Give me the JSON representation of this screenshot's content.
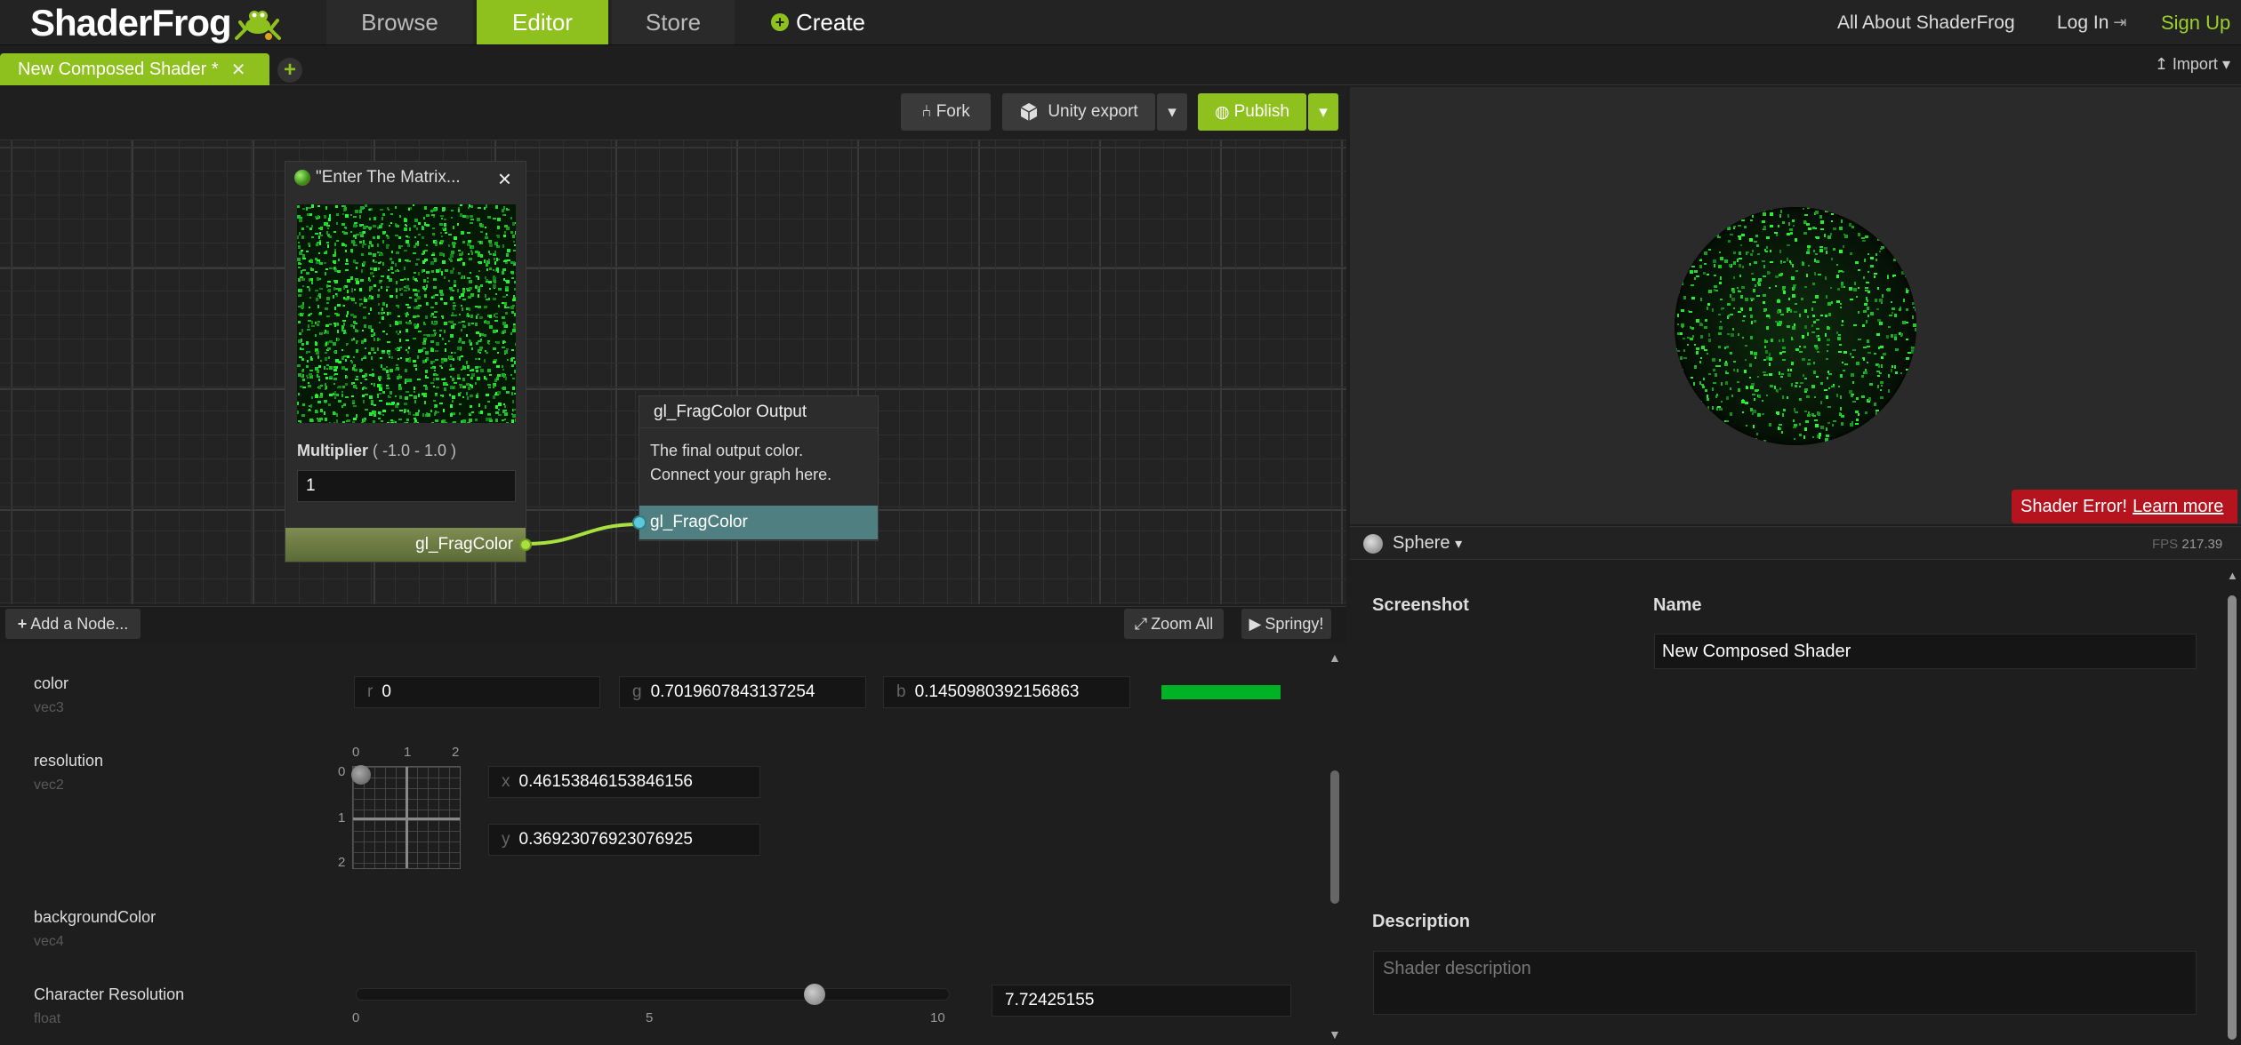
{
  "nav": {
    "logo": "ShaderFrog",
    "browse": "Browse",
    "editor": "Editor",
    "store": "Store",
    "create": "Create",
    "about": "All About ShaderFrog",
    "login": "Log In",
    "signup": "Sign Up",
    "active_color": "#8ec11d"
  },
  "tabs": {
    "active": "New Composed Shader *",
    "close_glyph": "✕",
    "add_glyph": "+",
    "import": "Import"
  },
  "toolbar": {
    "fork": "Fork",
    "unity_export": "Unity export",
    "publish": "Publish"
  },
  "graph": {
    "node1": {
      "title": "\"Enter The Matrix...",
      "multiplier_label": "Multiplier",
      "multiplier_range": "( -1.0 - 1.0 )",
      "multiplier_value": "1",
      "output_port": "gl_FragColor"
    },
    "node2": {
      "title": "gl_FragColor Output",
      "desc_line1": "The final output color.",
      "desc_line2": "Connect your graph here.",
      "input_port": "gl_FragColor"
    },
    "add_node": "Add a Node...",
    "zoom_all": "Zoom All",
    "springy": "Springy!"
  },
  "uniforms": [
    {
      "name": "color",
      "type": "vec3"
    },
    {
      "name": "resolution",
      "type": "vec2"
    },
    {
      "name": "backgroundColor",
      "type": "vec4"
    },
    {
      "name": "Character Resolution",
      "type": "float"
    }
  ],
  "color_uniform": {
    "r_label": "r",
    "r": "0",
    "g_label": "g",
    "g": "0.7019607843137254",
    "b_label": "b",
    "b": "0.1450980392156863",
    "swatch": "#00b325"
  },
  "resolution_uniform": {
    "x_label": "x",
    "x": "0.46153846153846156",
    "y_label": "y",
    "y": "0.36923076923076925",
    "ticks_top": [
      "0",
      "1",
      "2"
    ],
    "ticks_left": [
      "0",
      "1",
      "2"
    ]
  },
  "char_res_uniform": {
    "value": "7.72425155",
    "slider_fraction": 0.772425155,
    "ticks": [
      "0",
      "5",
      "10"
    ]
  },
  "preview": {
    "error": "Shader Error!",
    "learn_more": "Learn more",
    "geometry": "Sphere",
    "fps_label": "FPS",
    "fps_value": "217.39"
  },
  "form": {
    "screenshot_label": "Screenshot",
    "name_label": "Name",
    "name_value": "New Composed Shader",
    "description_label": "Description",
    "description_placeholder": "Shader description"
  }
}
